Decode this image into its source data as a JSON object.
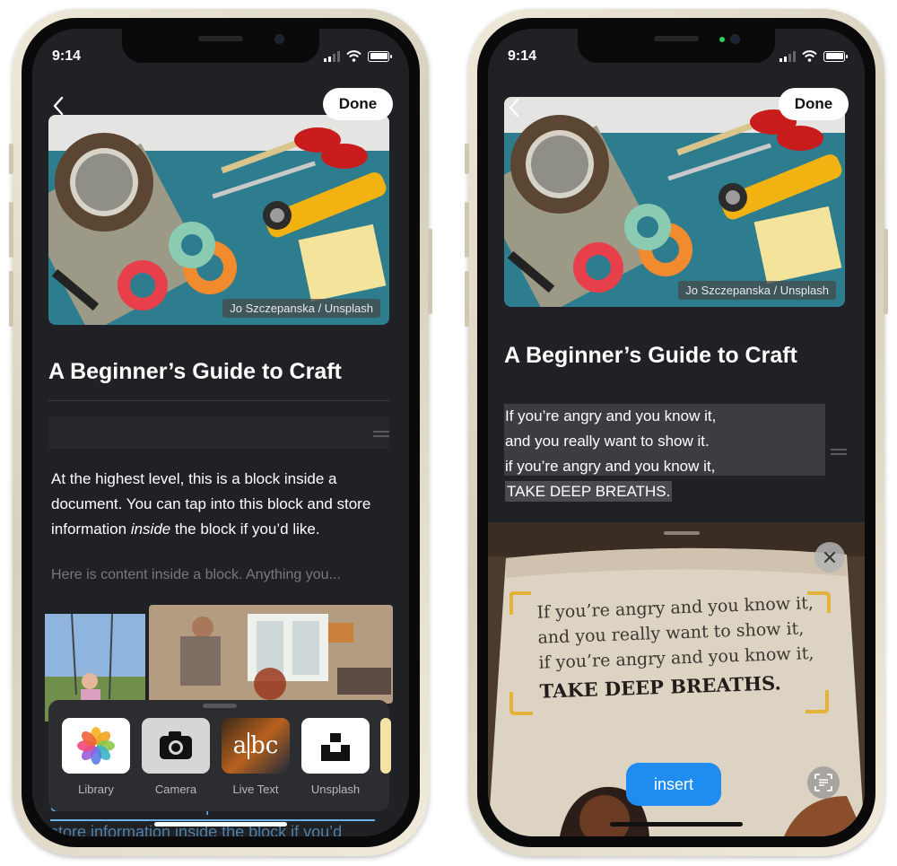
{
  "status": {
    "time": "9:14"
  },
  "left": {
    "done_label": "Done",
    "photo_credit": "Jo Szczepanska / Unsplash",
    "title": "A Beginner’s Guide to Craft",
    "paragraph_before": "At the highest level, this is a block inside a document. You can tap into this block and store information ",
    "paragraph_italic": "inside",
    "paragraph_after": " the block if you’d like.",
    "faded_text": "Here is content inside a block. Anything you...",
    "picker": {
      "items": [
        {
          "label": "Library",
          "icon": "photos-flower-icon"
        },
        {
          "label": "Camera",
          "icon": "camera-icon"
        },
        {
          "label": "Live Text",
          "icon": "live-text-icon",
          "glyph_a": "a",
          "glyph_bc": "bc"
        },
        {
          "label": "Unsplash",
          "icon": "unsplash-logo-icon"
        }
      ]
    },
    "underlined_1": "document. You can tap into this block and",
    "underlined_2": "store information inside the block if you’d"
  },
  "right": {
    "done_label": "Done",
    "photo_credit": "Jo Szczepanska / Unsplash",
    "title": "A Beginner’s Guide to Craft",
    "selected_lines": [
      "If you’re angry and you know it,",
      "and you really want to show it.",
      "if you’re angry and you know it,",
      "TAKE DEEP BREATHS."
    ],
    "book_lines": [
      "If you’re angry and you know it,",
      "and you really want to show it,",
      "if you’re angry and you know it,",
      "TAKE DEEP BREATHS."
    ],
    "insert_label": "insert"
  },
  "colors": {
    "screen_bg": "#1f2124",
    "accent_blue": "#1f8cf0",
    "link_blue": "#6cb1ea",
    "text_faded": "#77797d"
  }
}
